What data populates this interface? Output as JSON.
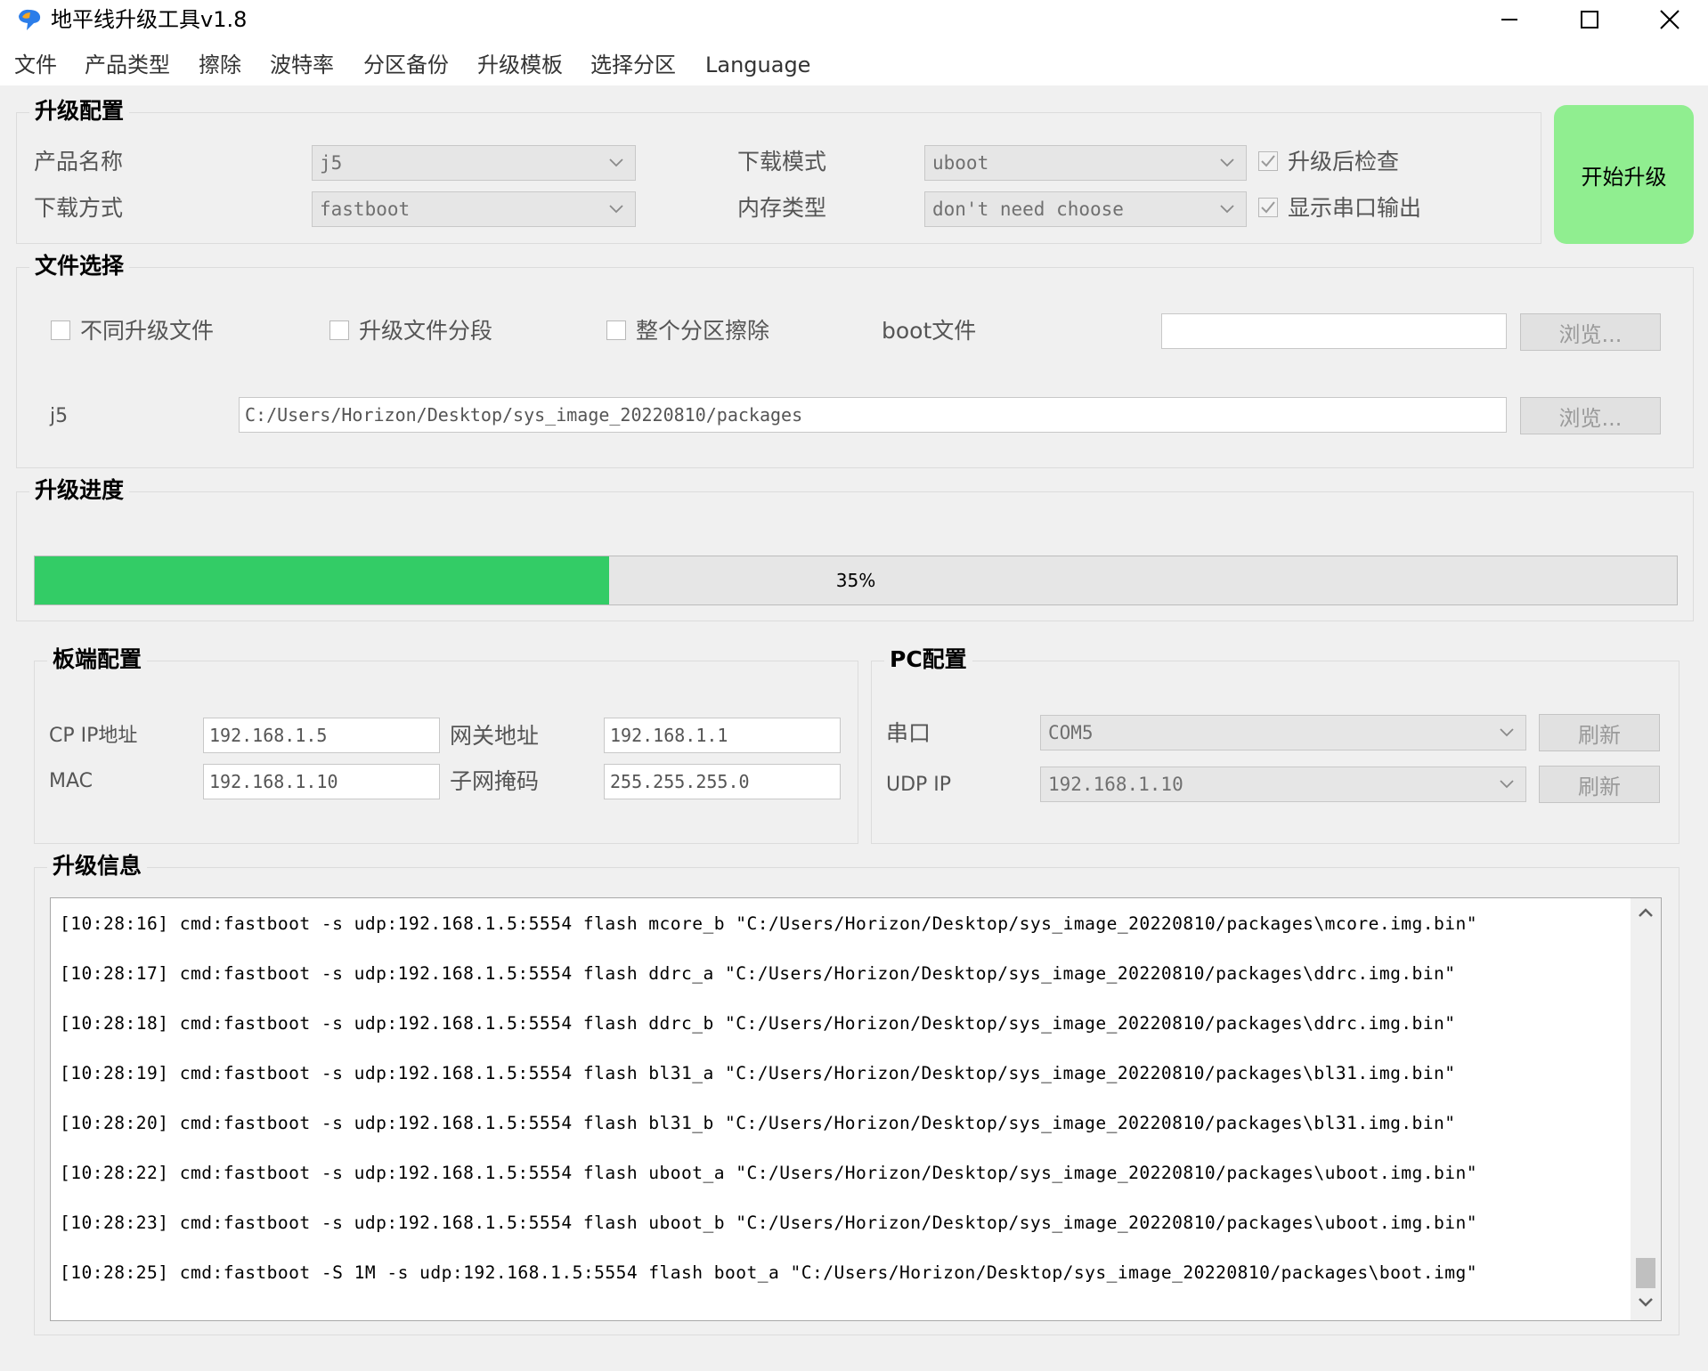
{
  "window": {
    "title": "地平线升级工具v1.8",
    "controls": [
      "minimize-icon",
      "maximize-icon",
      "close-icon"
    ]
  },
  "menu": [
    "文件",
    "产品类型",
    "擦除",
    "波特率",
    "分区备份",
    "升级模板",
    "选择分区",
    "Language"
  ],
  "upgrade_config": {
    "title": "升级配置",
    "product_name_label": "产品名称",
    "product_name_value": "j5",
    "download_method_label": "下载方式",
    "download_method_value": "fastboot",
    "download_mode_label": "下载模式",
    "download_mode_value": "uboot",
    "memory_type_label": "内存类型",
    "memory_type_value": "don't need choose",
    "check_after_upgrade": {
      "label": "升级后检查",
      "checked": true
    },
    "show_serial_output": {
      "label": "显示串口输出",
      "checked": true
    }
  },
  "start_button": {
    "label": "开始升级",
    "color": "#90ee90"
  },
  "file_select": {
    "title": "文件选择",
    "different_files": {
      "label": "不同升级文件",
      "checked": false
    },
    "file_segment": {
      "label": "升级文件分段",
      "checked": false
    },
    "whole_erase": {
      "label": "整个分区擦除",
      "checked": false
    },
    "boot_file_label": "boot文件",
    "boot_file_value": "",
    "browse_label": "浏览...",
    "j5_label": "j5",
    "j5_path": "C:/Users/Horizon/Desktop/sys_image_20220810/packages"
  },
  "progress": {
    "title": "升级进度",
    "percent": 35,
    "text": "35%",
    "bar_color": "#33cc66"
  },
  "board_config": {
    "title": "板端配置",
    "cp_ip_label": "CP IP地址",
    "cp_ip_value": "192.168.1.5",
    "gateway_label": "网关地址",
    "gateway_value": "192.168.1.1",
    "mac_label": "MAC",
    "mac_value": "192.168.1.10",
    "netmask_label": "子网掩码",
    "netmask_value": "255.255.255.0"
  },
  "pc_config": {
    "title": "PC配置",
    "serial_label": "串口",
    "serial_value": "COM5",
    "udp_ip_label": "UDP IP",
    "udp_ip_value": "192.168.1.10",
    "refresh_label": "刷新"
  },
  "upgrade_info": {
    "title": "升级信息",
    "lines": [
      "[10:28:16] cmd:fastboot -s udp:192.168.1.5:5554 flash mcore_b \"C:/Users/Horizon/Desktop/sys_image_20220810/packages\\mcore.img.bin\"",
      "[10:28:17] cmd:fastboot -s udp:192.168.1.5:5554 flash ddrc_a \"C:/Users/Horizon/Desktop/sys_image_20220810/packages\\ddrc.img.bin\"",
      "[10:28:18] cmd:fastboot -s udp:192.168.1.5:5554 flash ddrc_b \"C:/Users/Horizon/Desktop/sys_image_20220810/packages\\ddrc.img.bin\"",
      "[10:28:19] cmd:fastboot -s udp:192.168.1.5:5554 flash bl31_a \"C:/Users/Horizon/Desktop/sys_image_20220810/packages\\bl31.img.bin\"",
      "[10:28:20] cmd:fastboot -s udp:192.168.1.5:5554 flash bl31_b \"C:/Users/Horizon/Desktop/sys_image_20220810/packages\\bl31.img.bin\"",
      "[10:28:22] cmd:fastboot -s udp:192.168.1.5:5554 flash uboot_a \"C:/Users/Horizon/Desktop/sys_image_20220810/packages\\uboot.img.bin\"",
      "[10:28:23] cmd:fastboot -s udp:192.168.1.5:5554 flash uboot_b \"C:/Users/Horizon/Desktop/sys_image_20220810/packages\\uboot.img.bin\"",
      "[10:28:25] cmd:fastboot -S 1M -s udp:192.168.1.5:5554 flash boot_a \"C:/Users/Horizon/Desktop/sys_image_20220810/packages\\boot.img\""
    ]
  }
}
